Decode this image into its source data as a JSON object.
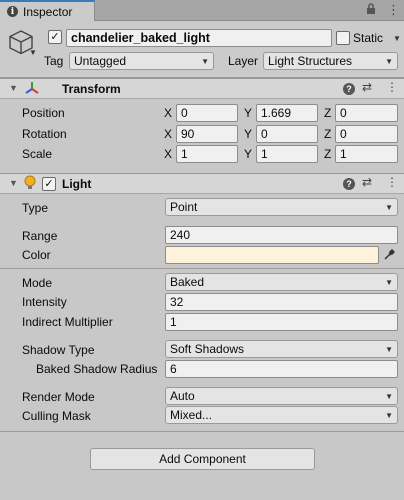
{
  "tab": {
    "title": "Inspector"
  },
  "gameobject": {
    "active": true,
    "name": "chandelier_baked_light",
    "static_label": "Static",
    "tag_label": "Tag",
    "tag_value": "Untagged",
    "layer_label": "Layer",
    "layer_value": "Light Structures"
  },
  "transform": {
    "title": "Transform",
    "rows": [
      {
        "label": "Position",
        "x": "0",
        "y": "1.669",
        "z": "0"
      },
      {
        "label": "Rotation",
        "x": "90",
        "y": "0",
        "z": "0"
      },
      {
        "label": "Scale",
        "x": "1",
        "y": "1",
        "z": "1"
      }
    ],
    "axis": {
      "x": "X",
      "y": "Y",
      "z": "Z"
    }
  },
  "light": {
    "title": "Light",
    "enabled": true,
    "type_label": "Type",
    "type_value": "Point",
    "range_label": "Range",
    "range_value": "240",
    "color_label": "Color",
    "color_hex": "#fff2db",
    "mode_label": "Mode",
    "mode_value": "Baked",
    "intensity_label": "Intensity",
    "intensity_value": "32",
    "indirect_label": "Indirect Multiplier",
    "indirect_value": "1",
    "shadow_type_label": "Shadow Type",
    "shadow_type_value": "Soft Shadows",
    "baked_radius_label": "Baked Shadow Radius",
    "baked_radius_value": "6",
    "render_mode_label": "Render Mode",
    "render_mode_value": "Auto",
    "culling_mask_label": "Culling Mask",
    "culling_mask_value": "Mixed..."
  },
  "add_component_label": "Add Component",
  "colors": {
    "tab_accent": "#3a79bb",
    "panel_bg": "#c8c8c8"
  },
  "icons": [
    "info-icon",
    "lock-icon",
    "menu-icon",
    "cube-icon",
    "transform-icon",
    "light-bulb-icon",
    "help-icon",
    "presets-icon",
    "context-menu-icon",
    "eyedropper-icon",
    "foldout-icon",
    "dropdown-arrow-icon",
    "checkmark-icon"
  ]
}
